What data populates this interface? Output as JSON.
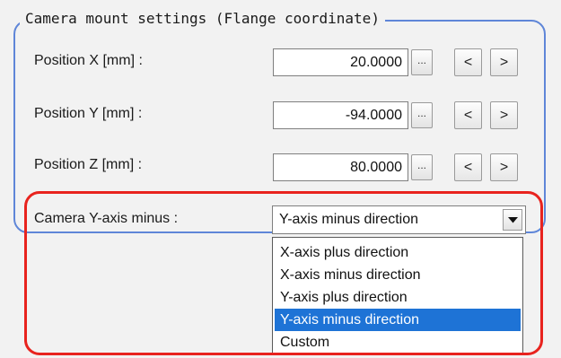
{
  "group": {
    "title": "Camera mount settings (Flange coordinate)"
  },
  "fields": [
    {
      "label": "Position X [mm] :",
      "value": "20.0000"
    },
    {
      "label": "Position Y [mm] :",
      "value": "-94.0000"
    },
    {
      "label": "Position Z [mm] :",
      "value": "80.0000"
    }
  ],
  "buttons": {
    "ellipsis": "...",
    "decrement": "<",
    "increment": ">"
  },
  "camera_y_axis": {
    "label": "Camera Y-axis minus :",
    "selected": "Y-axis minus direction",
    "options": [
      "X-axis plus direction",
      "X-axis minus direction",
      "Y-axis plus direction",
      "Y-axis minus direction",
      "Custom"
    ],
    "selected_index": 3
  },
  "colors": {
    "group_border": "#5f86d8",
    "highlight": "#e8231e",
    "selection": "#1e73d6"
  },
  "icons": {
    "combo_arrow": "chevron-down-icon"
  }
}
